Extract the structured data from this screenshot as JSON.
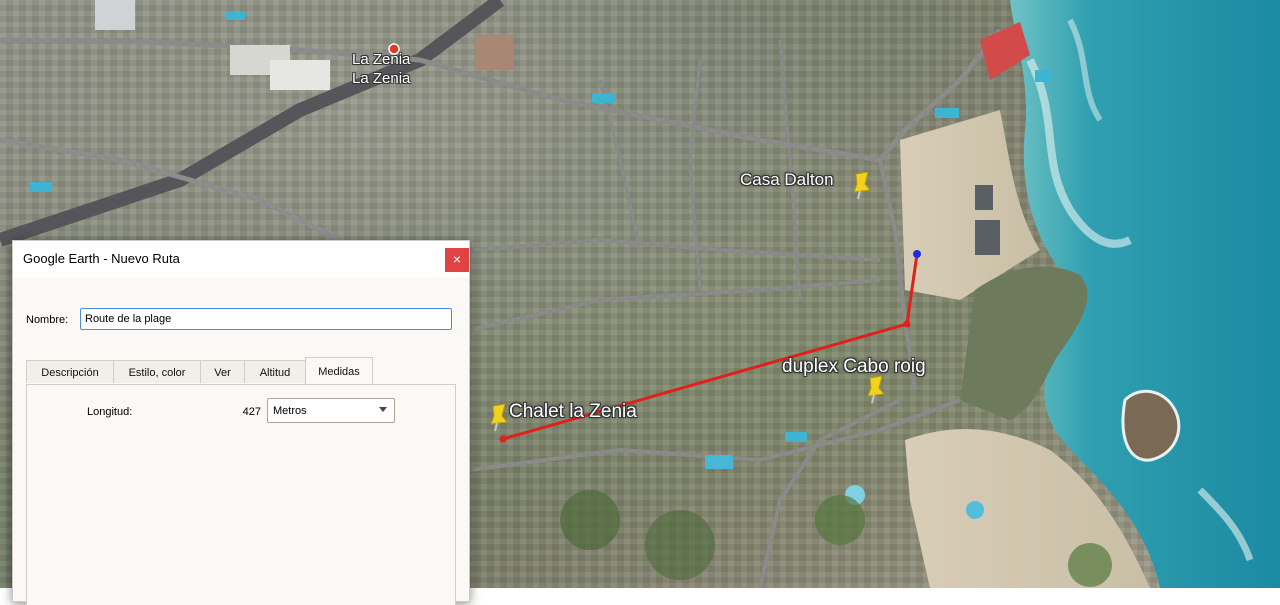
{
  "map": {
    "labels": {
      "la_zenia_1": "La Zenia",
      "la_zenia_2": "La Zenia",
      "casa_dalton": "Casa Dalton",
      "duplex_cabo_roig": "duplex Cabo roig",
      "chalet_la_zenia": "Chalet la Zenia"
    },
    "route_color": "#e0201c",
    "sea_color": "#2e9fb0",
    "pin_color": "#f2d21c"
  },
  "dialog": {
    "title": "Google Earth - Nuevo Ruta",
    "close_label": "×",
    "name_label": "Nombre:",
    "name_value": "Route de la plage",
    "tabs": [
      {
        "label": "Descripción"
      },
      {
        "label": "Estilo, color"
      },
      {
        "label": "Ver"
      },
      {
        "label": "Altitud"
      },
      {
        "label": "Medidas"
      }
    ],
    "active_tab": "Medidas",
    "measure": {
      "length_label": "Longitud:",
      "length_value": "427",
      "unit": "Metros"
    }
  }
}
